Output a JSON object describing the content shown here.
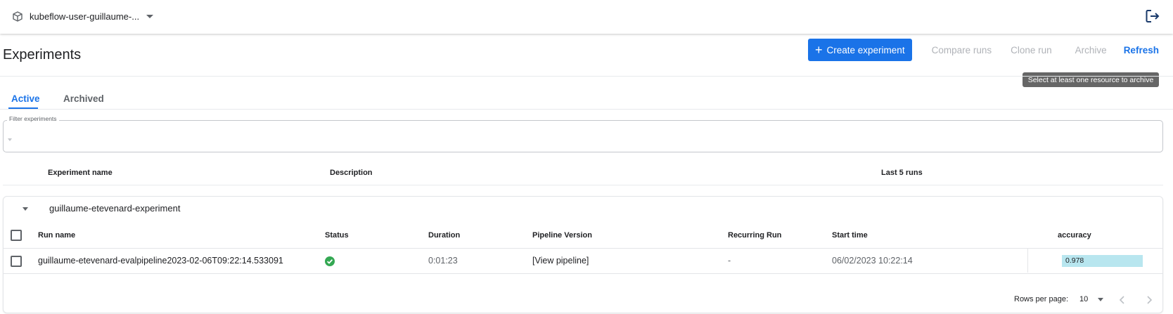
{
  "namespace": {
    "label": "kubeflow-user-guillaume-..."
  },
  "header": {
    "title": "Experiments",
    "create_label": "Create experiment",
    "compare_label": "Compare runs",
    "clone_label": "Clone run",
    "archive_label": "Archive",
    "refresh_label": "Refresh",
    "tooltip": "Select at least one resource to archive"
  },
  "tabs": [
    {
      "label": "Active",
      "selected": true
    },
    {
      "label": "Archived",
      "selected": false
    }
  ],
  "filter": {
    "legend": "Filter experiments",
    "value": ""
  },
  "experiment_table": {
    "columns": [
      "Experiment name",
      "Description",
      "Last 5 runs"
    ]
  },
  "experiment": {
    "name": "guillaume-etevenard-experiment",
    "run_columns": [
      "Run name",
      "Status",
      "Duration",
      "Pipeline Version",
      "Recurring Run",
      "Start time",
      "accuracy"
    ],
    "runs": [
      {
        "name": "guillaume-etevenard-evalpipeline2023-02-06T09:22:14.533091",
        "status": "success",
        "duration": "0:01:23",
        "pipeline_version": "[View pipeline]",
        "recurring_run": "-",
        "start_time": "06/02/2023 10:22:14",
        "accuracy": "0.978"
      }
    ]
  },
  "pagination": {
    "rows_label": "Rows per page:",
    "rows_value": "10"
  },
  "colors": {
    "accent": "#1a73e8",
    "success": "#34a853",
    "accuracy_bar": "#b8e6ef"
  },
  "icons": [
    "cube-icon",
    "logout-icon",
    "plus-icon",
    "filter-icon",
    "check-circle-icon",
    "chevron-left-icon",
    "chevron-right-icon"
  ]
}
